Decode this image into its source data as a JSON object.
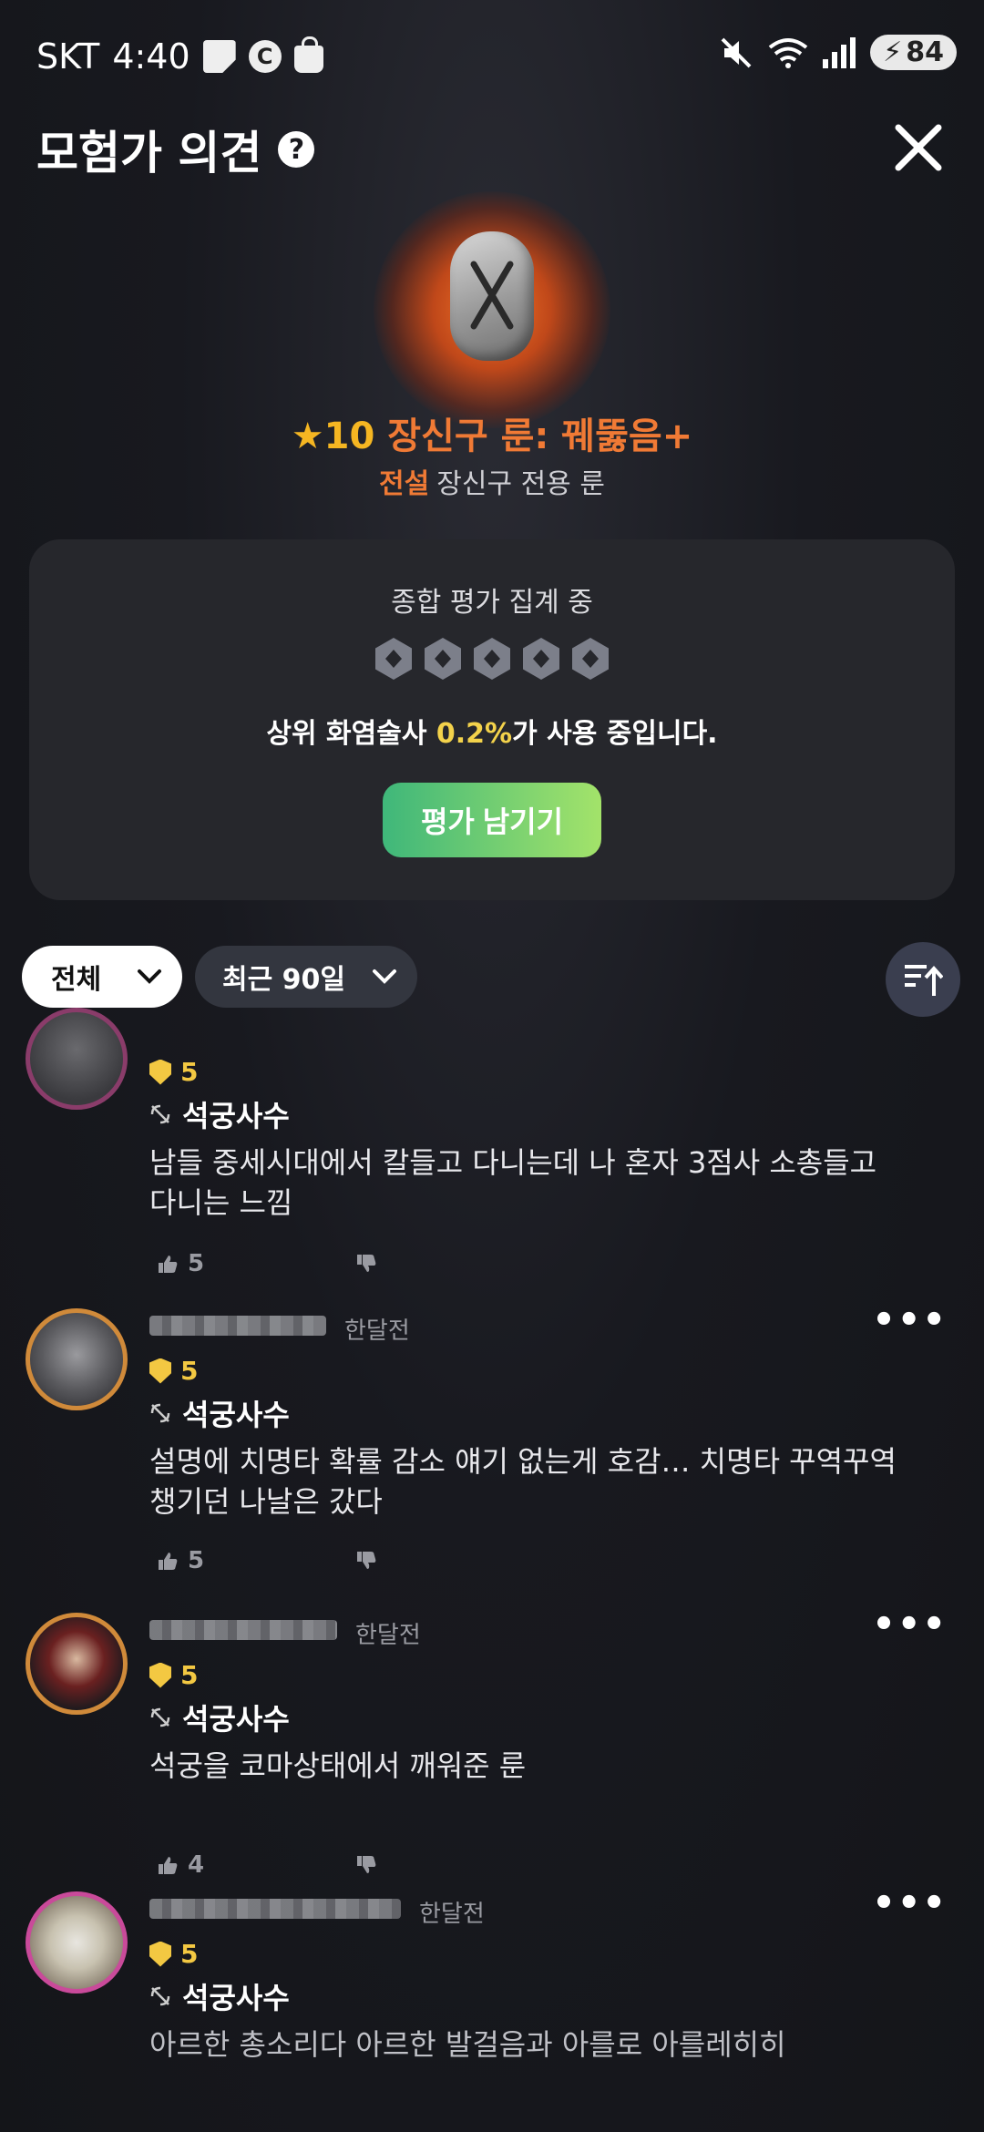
{
  "status": {
    "carrier": "SKT",
    "time": "4:40",
    "battery": "84",
    "left_icons": [
      "note-icon",
      "c-icon",
      "shopping-bag-icon"
    ],
    "right_icons": [
      "mute-icon",
      "wifi-icon",
      "signal-icon",
      "battery-icon"
    ]
  },
  "header": {
    "title": "모험가 의견",
    "help": "?",
    "close": "close-icon"
  },
  "item": {
    "star": "★",
    "level": "10",
    "name": "장신구 룬: 꿰뚫음+",
    "rarity": "전설",
    "subtitle": "장신구 전용 룬",
    "icon": "rune-stone-icon",
    "glow_color": "#f07a35"
  },
  "rating": {
    "status": "종합 평가 집계 중",
    "gem_count": 5,
    "usage_prefix": "상위 화염술사 ",
    "usage_pct": "0.2%",
    "usage_suffix": "가 사용 중입니다.",
    "button": "평가 남기기"
  },
  "filters": {
    "type": "전체",
    "period": "최근 90일",
    "sort_icon": "sort-ascending-icon"
  },
  "comments": [
    {
      "level": "5",
      "class": "석궁사수",
      "text_lines": [
        "남들 중세시대에서 칼들고 다니는데 나 혼자 3점사 소총들고",
        "다니는 느낌"
      ],
      "likes": "5",
      "time": ""
    },
    {
      "level": "5",
      "class": "석궁사수",
      "time": "한달전",
      "text_lines": [
        "설명에 치명타 확률 감소 얘기 없는게 호감… 치명타 꾸역꾸역",
        "챙기던 나날은 갔다"
      ],
      "likes": "5"
    },
    {
      "level": "5",
      "class": "석궁사수",
      "time": "한달전",
      "text_lines": [
        "석궁을 코마상태에서 깨워준 룬"
      ],
      "likes": "4"
    },
    {
      "level": "5",
      "class": "석궁사수",
      "time": "한달전",
      "text_lines": [
        "아르한 총소리다 아르한 발걸음과 아를로 아를레히히"
      ],
      "likes": ""
    }
  ],
  "colors": {
    "accent_orange": "#f07a35",
    "gold": "#f3c842",
    "button_start": "#3fb77a",
    "button_end": "#a3e36a",
    "card": "#26272c"
  }
}
